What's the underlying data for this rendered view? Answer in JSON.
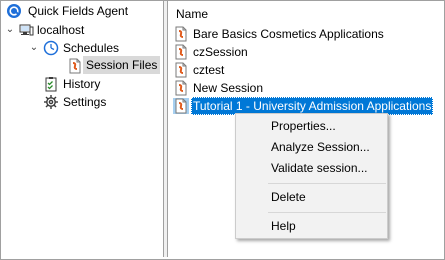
{
  "tree": {
    "root": {
      "label": "Quick Fields Agent",
      "icon": "quick-fields-agent-icon"
    },
    "server": {
      "label": "localhost",
      "icon": "computer-icon",
      "expand": "collapse-chevron"
    },
    "schedules": {
      "label": "Schedules",
      "icon": "clock-icon",
      "expand": "collapse-chevron"
    },
    "session_files": {
      "label": "Session Files",
      "icon": "session-file-icon",
      "selected": true
    },
    "history": {
      "label": "History",
      "icon": "history-checklist-icon"
    },
    "settings": {
      "label": "Settings",
      "icon": "gear-icon"
    }
  },
  "list": {
    "column_header": "Name",
    "files": [
      {
        "name": "Bare Basics Cosmetics Applications",
        "icon": "session-file-icon"
      },
      {
        "name": "czSession",
        "icon": "session-file-icon"
      },
      {
        "name": "cztest",
        "icon": "session-file-icon"
      },
      {
        "name": "New Session",
        "icon": "session-file-icon"
      },
      {
        "name": "Tutorial 1 - University Admission Applications",
        "icon": "session-file-icon",
        "selected": true
      }
    ]
  },
  "context_menu": {
    "items": [
      {
        "label": "Properties..."
      },
      {
        "label": "Analyze Session..."
      },
      {
        "label": "Validate session..."
      },
      {
        "label": "Delete"
      },
      {
        "label": "Help"
      }
    ]
  },
  "colors": {
    "selection": "#0078d7",
    "menu_bg": "#f2f2f2",
    "accent_blue": "#1e6fd9"
  }
}
